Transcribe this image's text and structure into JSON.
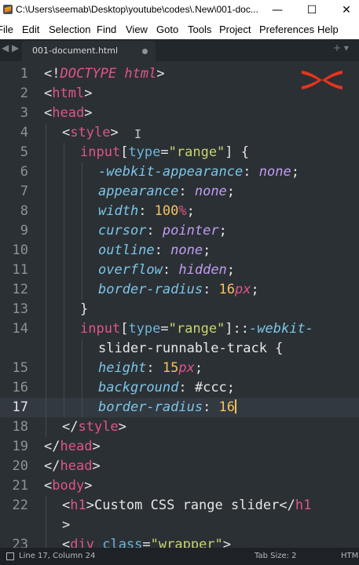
{
  "window": {
    "title": "C:\\Users\\seemab\\Desktop\\youtube\\codes\\.New\\001-doc...",
    "minimize": "—",
    "maximize": "☐",
    "close": "✕"
  },
  "menu": {
    "items": [
      "File",
      "Edit",
      "Selection",
      "Find",
      "View",
      "Goto",
      "Tools",
      "Project",
      "Preferences",
      "Help"
    ]
  },
  "tabs": {
    "active_label": "001-document.html",
    "nav_left": "◀ ▶",
    "nav_right": "+ ▾"
  },
  "editor": {
    "active_line": 17,
    "lines": [
      {
        "num": "1",
        "indent": 0,
        "tokens": [
          {
            "t": "<!",
            "c": "punct"
          },
          {
            "t": "DOCTYPE html",
            "c": "doc"
          },
          {
            "t": ">",
            "c": "punct"
          }
        ]
      },
      {
        "num": "2",
        "indent": 0,
        "tokens": [
          {
            "t": "<",
            "c": "punct"
          },
          {
            "t": "html",
            "c": "tag"
          },
          {
            "t": ">",
            "c": "punct"
          }
        ]
      },
      {
        "num": "3",
        "indent": 0,
        "tokens": [
          {
            "t": "<",
            "c": "punct"
          },
          {
            "t": "head",
            "c": "tag"
          },
          {
            "t": ">",
            "c": "punct"
          }
        ]
      },
      {
        "num": "4",
        "indent": 1,
        "tokens": [
          {
            "t": "<",
            "c": "punct"
          },
          {
            "t": "style",
            "c": "tag"
          },
          {
            "t": ">",
            "c": "punct"
          }
        ]
      },
      {
        "num": "5",
        "indent": 2,
        "tokens": [
          {
            "t": "input",
            "c": "sel"
          },
          {
            "t": "[",
            "c": "punct"
          },
          {
            "t": "type",
            "c": "attr"
          },
          {
            "t": "=",
            "c": "punct"
          },
          {
            "t": "\"range\"",
            "c": "str"
          },
          {
            "t": "] {",
            "c": "punct"
          }
        ]
      },
      {
        "num": "6",
        "indent": 3,
        "tokens": [
          {
            "t": "-webkit-",
            "c": "vendor"
          },
          {
            "t": "appearance",
            "c": "prop"
          },
          {
            "t": ": ",
            "c": "punct"
          },
          {
            "t": "none",
            "c": "val"
          },
          {
            "t": ";",
            "c": "punct"
          }
        ]
      },
      {
        "num": "7",
        "indent": 3,
        "tokens": [
          {
            "t": "appearance",
            "c": "prop"
          },
          {
            "t": ": ",
            "c": "punct"
          },
          {
            "t": "none",
            "c": "val"
          },
          {
            "t": ";",
            "c": "punct"
          }
        ]
      },
      {
        "num": "8",
        "indent": 3,
        "tokens": [
          {
            "t": "width",
            "c": "prop"
          },
          {
            "t": ": ",
            "c": "punct"
          },
          {
            "t": "100",
            "c": "num"
          },
          {
            "t": "%",
            "c": "unit"
          },
          {
            "t": ";",
            "c": "punct"
          }
        ]
      },
      {
        "num": "9",
        "indent": 3,
        "tokens": [
          {
            "t": "cursor",
            "c": "prop"
          },
          {
            "t": ": ",
            "c": "punct"
          },
          {
            "t": "pointer",
            "c": "val"
          },
          {
            "t": ";",
            "c": "punct"
          }
        ]
      },
      {
        "num": "10",
        "indent": 3,
        "tokens": [
          {
            "t": "outline",
            "c": "prop"
          },
          {
            "t": ": ",
            "c": "punct"
          },
          {
            "t": "none",
            "c": "val"
          },
          {
            "t": ";",
            "c": "punct"
          }
        ]
      },
      {
        "num": "11",
        "indent": 3,
        "tokens": [
          {
            "t": "overflow",
            "c": "prop"
          },
          {
            "t": ": ",
            "c": "punct"
          },
          {
            "t": "hidden",
            "c": "val"
          },
          {
            "t": ";",
            "c": "punct"
          }
        ]
      },
      {
        "num": "12",
        "indent": 3,
        "tokens": [
          {
            "t": "border-radius",
            "c": "prop"
          },
          {
            "t": ": ",
            "c": "punct"
          },
          {
            "t": "16",
            "c": "num"
          },
          {
            "t": "px",
            "c": "unit"
          },
          {
            "t": ";",
            "c": "punct"
          }
        ]
      },
      {
        "num": "13",
        "indent": 2,
        "tokens": [
          {
            "t": "}",
            "c": "punct"
          }
        ]
      },
      {
        "num": "14",
        "indent": 2,
        "tokens": [
          {
            "t": "input",
            "c": "sel"
          },
          {
            "t": "[",
            "c": "punct"
          },
          {
            "t": "type",
            "c": "attr"
          },
          {
            "t": "=",
            "c": "punct"
          },
          {
            "t": "\"range\"",
            "c": "str"
          },
          {
            "t": "]::",
            "c": "punct"
          },
          {
            "t": "-webkit-",
            "c": "vendor"
          }
        ]
      },
      {
        "num": "",
        "indent": 3,
        "tokens": [
          {
            "t": "slider-runnable-track",
            "c": "text"
          },
          {
            "t": " {",
            "c": "punct"
          }
        ]
      },
      {
        "num": "15",
        "indent": 3,
        "tokens": [
          {
            "t": "height",
            "c": "prop"
          },
          {
            "t": ": ",
            "c": "punct"
          },
          {
            "t": "15",
            "c": "num"
          },
          {
            "t": "px",
            "c": "unit"
          },
          {
            "t": ";",
            "c": "punct"
          }
        ]
      },
      {
        "num": "16",
        "indent": 3,
        "tokens": [
          {
            "t": "background",
            "c": "prop"
          },
          {
            "t": ": ",
            "c": "punct"
          },
          {
            "t": "#ccc",
            "c": "text"
          },
          {
            "t": ";",
            "c": "punct"
          }
        ]
      },
      {
        "num": "17",
        "indent": 3,
        "tokens": [
          {
            "t": "border-radius",
            "c": "prop"
          },
          {
            "t": ": ",
            "c": "punct"
          },
          {
            "t": "16",
            "c": "num"
          }
        ],
        "cursor": true
      },
      {
        "num": "18",
        "indent": 1,
        "tokens": [
          {
            "t": "</",
            "c": "punct"
          },
          {
            "t": "style",
            "c": "tag"
          },
          {
            "t": ">",
            "c": "punct"
          }
        ]
      },
      {
        "num": "19",
        "indent": 0,
        "tokens": [
          {
            "t": "</",
            "c": "punct"
          },
          {
            "t": "head",
            "c": "tag"
          },
          {
            "t": ">",
            "c": "punct"
          }
        ]
      },
      {
        "num": "20",
        "indent": 0,
        "tokens": [
          {
            "t": "</",
            "c": "punct"
          },
          {
            "t": "head",
            "c": "tag"
          },
          {
            "t": ">",
            "c": "punct"
          }
        ]
      },
      {
        "num": "21",
        "indent": 0,
        "tokens": [
          {
            "t": "<",
            "c": "punct"
          },
          {
            "t": "body",
            "c": "tag"
          },
          {
            "t": ">",
            "c": "punct"
          }
        ]
      },
      {
        "num": "22",
        "indent": 1,
        "tokens": [
          {
            "t": "<",
            "c": "punct"
          },
          {
            "t": "h1",
            "c": "tag"
          },
          {
            "t": ">",
            "c": "punct"
          },
          {
            "t": "Custom CSS range slider",
            "c": "text"
          },
          {
            "t": "</",
            "c": "punct"
          },
          {
            "t": "h1",
            "c": "tag"
          }
        ]
      },
      {
        "num": "",
        "indent": 1,
        "tokens": [
          {
            "t": ">",
            "c": "punct"
          }
        ]
      },
      {
        "num": "23",
        "indent": 1,
        "tokens": [
          {
            "t": "<",
            "c": "punct"
          },
          {
            "t": "div",
            "c": "tag"
          },
          {
            "t": " ",
            "c": "punct"
          },
          {
            "t": "class",
            "c": "attr"
          },
          {
            "t": "=",
            "c": "punct"
          },
          {
            "t": "\"wrapper\"",
            "c": "str"
          },
          {
            "t": ">",
            "c": "punct"
          }
        ]
      }
    ]
  },
  "status": {
    "position": "Line 17, Column 24",
    "tab_size": "Tab Size: 2",
    "syntax": "HTM"
  },
  "colors": {
    "editor_bg": "#2b3035",
    "accent_red": "#e8341c",
    "tag_pink": "#e0548c",
    "number_orange": "#f5c35c"
  },
  "icons": {
    "app": "sublime-text-icon",
    "logo": "brand-x-logo"
  }
}
